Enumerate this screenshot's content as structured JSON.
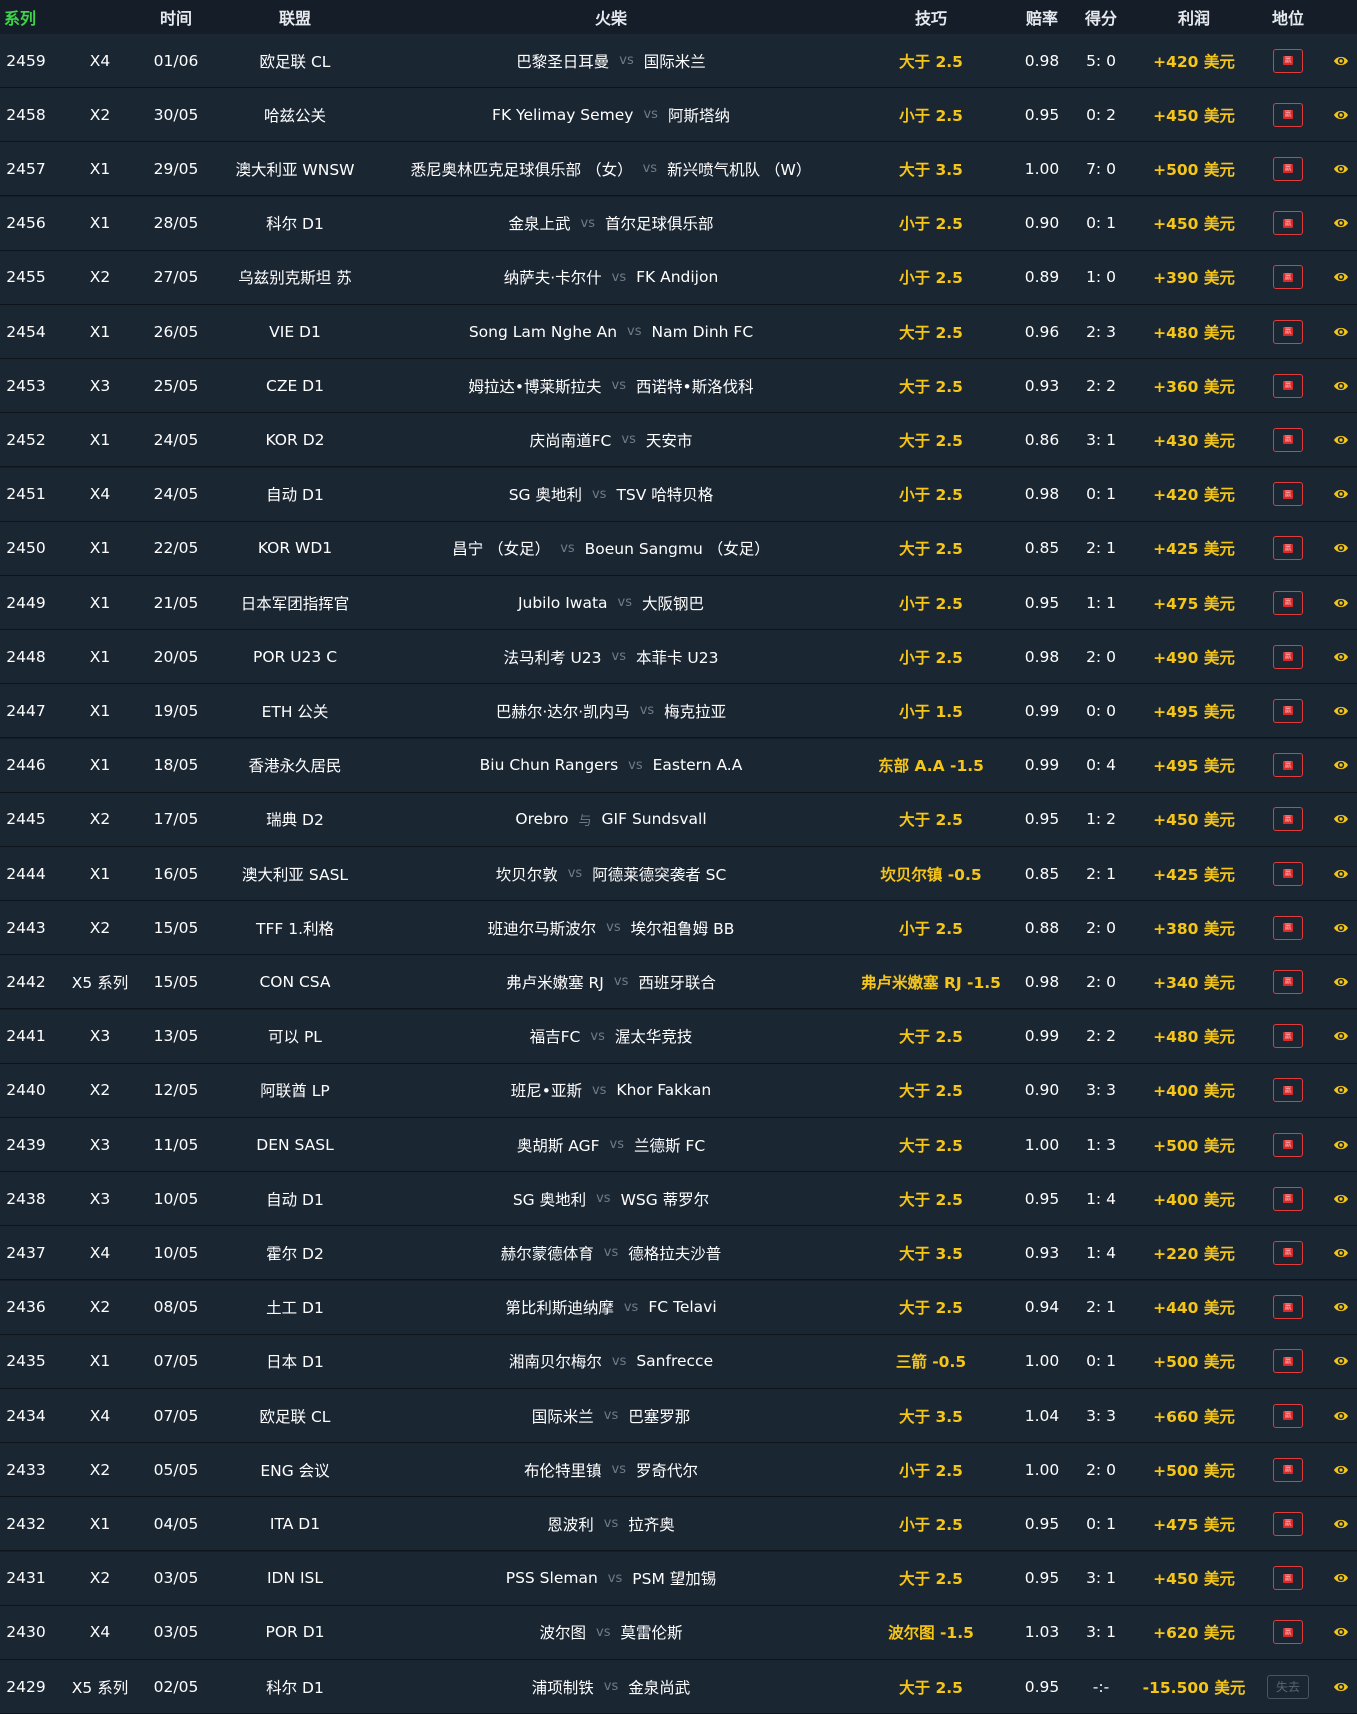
{
  "columns": [
    "系列",
    "",
    "时间",
    "联盟",
    "火柴",
    "技巧",
    "赔率",
    "得分",
    "利润",
    "地位"
  ],
  "accent_colors": {
    "header_id": "#3fd44a",
    "tip": "#f5c518",
    "win_badge": "#d82a2a",
    "background": "#141d28",
    "row": "#1b2633"
  },
  "rows": [
    {
      "id": "2459",
      "series": "X4",
      "date": "01/06",
      "league": "欧足联 CL",
      "home": "巴黎圣日耳曼",
      "sep": "vs",
      "away": "国际米兰",
      "tip": "大于 2.5",
      "odds": "0.98",
      "score": "5: 0",
      "profit": "+420 美元",
      "status": "赢"
    },
    {
      "id": "2458",
      "series": "X2",
      "date": "30/05",
      "league": "哈兹公关",
      "home": "FK Yelimay Semey",
      "sep": "vs",
      "away": "阿斯塔纳",
      "tip": "小于 2.5",
      "odds": "0.95",
      "score": "0: 2",
      "profit": "+450 美元",
      "status": "赢"
    },
    {
      "id": "2457",
      "series": "X1",
      "date": "29/05",
      "league": "澳大利亚 WNSW",
      "home": "悉尼奥林匹克足球俱乐部 （女）",
      "sep": "vs",
      "away": "新兴喷气机队 （W）",
      "tip": "大于 3.5",
      "odds": "1.00",
      "score": "7: 0",
      "profit": "+500 美元",
      "status": "赢"
    },
    {
      "id": "2456",
      "series": "X1",
      "date": "28/05",
      "league": "科尔 D1",
      "home": "金泉上武",
      "sep": "vs",
      "away": "首尔足球俱乐部",
      "tip": "小于 2.5",
      "odds": "0.90",
      "score": "0: 1",
      "profit": "+450 美元",
      "status": "赢"
    },
    {
      "id": "2455",
      "series": "X2",
      "date": "27/05",
      "league": "乌兹别克斯坦 苏",
      "home": "纳萨夫·卡尔什",
      "sep": "vs",
      "away": "FK Andijon",
      "tip": "小于 2.5",
      "odds": "0.89",
      "score": "1: 0",
      "profit": "+390 美元",
      "status": "赢"
    },
    {
      "id": "2454",
      "series": "X1",
      "date": "26/05",
      "league": "VIE D1",
      "home": "Song Lam Nghe An",
      "sep": "vs",
      "away": "Nam Dinh FC",
      "tip": "大于 2.5",
      "odds": "0.96",
      "score": "2: 3",
      "profit": "+480 美元",
      "status": "赢"
    },
    {
      "id": "2453",
      "series": "X3",
      "date": "25/05",
      "league": "CZE D1",
      "home": "姆拉达•博莱斯拉夫",
      "sep": "vs",
      "away": "西诺特•斯洛伐科",
      "tip": "大于 2.5",
      "odds": "0.93",
      "score": "2: 2",
      "profit": "+360 美元",
      "status": "赢"
    },
    {
      "id": "2452",
      "series": "X1",
      "date": "24/05",
      "league": "KOR D2",
      "home": "庆尚南道FC",
      "sep": "vs",
      "away": "天安市",
      "tip": "大于 2.5",
      "odds": "0.86",
      "score": "3: 1",
      "profit": "+430 美元",
      "status": "赢"
    },
    {
      "id": "2451",
      "series": "X4",
      "date": "24/05",
      "league": "自动 D1",
      "home": "SG 奥地利",
      "sep": "vs",
      "away": "TSV 哈特贝格",
      "tip": "小于 2.5",
      "odds": "0.98",
      "score": "0: 1",
      "profit": "+420 美元",
      "status": "赢"
    },
    {
      "id": "2450",
      "series": "X1",
      "date": "22/05",
      "league": "KOR WD1",
      "home": "昌宁 （女足）",
      "sep": "vs",
      "away": "Boeun Sangmu （女足）",
      "tip": "大于 2.5",
      "odds": "0.85",
      "score": "2: 1",
      "profit": "+425 美元",
      "status": "赢"
    },
    {
      "id": "2449",
      "series": "X1",
      "date": "21/05",
      "league": "日本军团指挥官",
      "home": "Jubilo Iwata",
      "sep": "vs",
      "away": "大阪钢巴",
      "tip": "小于 2.5",
      "odds": "0.95",
      "score": "1: 1",
      "profit": "+475 美元",
      "status": "赢"
    },
    {
      "id": "2448",
      "series": "X1",
      "date": "20/05",
      "league": "POR U23 C",
      "home": "法马利考 U23",
      "sep": "vs",
      "away": "本菲卡 U23",
      "tip": "小于 2.5",
      "odds": "0.98",
      "score": "2: 0",
      "profit": "+490 美元",
      "status": "赢"
    },
    {
      "id": "2447",
      "series": "X1",
      "date": "19/05",
      "league": "ETH 公关",
      "home": "巴赫尔·达尔·凯内马",
      "sep": "vs",
      "away": "梅克拉亚",
      "tip": "小于 1.5",
      "odds": "0.99",
      "score": "0: 0",
      "profit": "+495 美元",
      "status": "赢"
    },
    {
      "id": "2446",
      "series": "X1",
      "date": "18/05",
      "league": "香港永久居民",
      "home": "Biu Chun Rangers",
      "sep": "vs",
      "away": "Eastern A.A",
      "tip": "东部 A.A -1.5",
      "odds": "0.99",
      "score": "0: 4",
      "profit": "+495 美元",
      "status": "赢"
    },
    {
      "id": "2445",
      "series": "X2",
      "date": "17/05",
      "league": "瑞典 D2",
      "home": "Orebro",
      "sep": "与",
      "away": "GIF Sundsvall",
      "tip": "大于 2.5",
      "odds": "0.95",
      "score": "1: 2",
      "profit": "+450 美元",
      "status": "赢"
    },
    {
      "id": "2444",
      "series": "X1",
      "date": "16/05",
      "league": "澳大利亚 SASL",
      "home": "坎贝尔敦",
      "sep": "vs",
      "away": "阿德莱德突袭者 SC",
      "tip": "坎贝尔镇 -0.5",
      "odds": "0.85",
      "score": "2: 1",
      "profit": "+425 美元",
      "status": "赢"
    },
    {
      "id": "2443",
      "series": "X2",
      "date": "15/05",
      "league": "TFF 1.利格",
      "home": "班迪尔马斯波尔",
      "sep": "vs",
      "away": "埃尔祖鲁姆 BB",
      "tip": "小于 2.5",
      "odds": "0.88",
      "score": "2: 0",
      "profit": "+380 美元",
      "status": "赢"
    },
    {
      "id": "2442",
      "series": "X5 系列",
      "date": "15/05",
      "league": "CON CSA",
      "home": "弗卢米嫩塞 RJ",
      "sep": "vs",
      "away": "西班牙联合",
      "tip": "弗卢米嫩塞 RJ -1.5",
      "odds": "0.98",
      "score": "2: 0",
      "profit": "+340 美元",
      "status": "赢"
    },
    {
      "id": "2441",
      "series": "X3",
      "date": "13/05",
      "league": "可以 PL",
      "home": "福吉FC",
      "sep": "vs",
      "away": "渥太华竞技",
      "tip": "大于 2.5",
      "odds": "0.99",
      "score": "2: 2",
      "profit": "+480 美元",
      "status": "赢"
    },
    {
      "id": "2440",
      "series": "X2",
      "date": "12/05",
      "league": "阿联酋 LP",
      "home": "班尼•亚斯",
      "sep": "vs",
      "away": "Khor Fakkan",
      "tip": "大于 2.5",
      "odds": "0.90",
      "score": "3: 3",
      "profit": "+400 美元",
      "status": "赢"
    },
    {
      "id": "2439",
      "series": "X3",
      "date": "11/05",
      "league": "DEN SASL",
      "home": "奥胡斯 AGF",
      "sep": "vs",
      "away": "兰德斯 FC",
      "tip": "大于 2.5",
      "odds": "1.00",
      "score": "1: 3",
      "profit": "+500 美元",
      "status": "赢"
    },
    {
      "id": "2438",
      "series": "X3",
      "date": "10/05",
      "league": "自动 D1",
      "home": "SG 奥地利",
      "sep": "vs",
      "away": "WSG 蒂罗尔",
      "tip": "大于 2.5",
      "odds": "0.95",
      "score": "1: 4",
      "profit": "+400 美元",
      "status": "赢"
    },
    {
      "id": "2437",
      "series": "X4",
      "date": "10/05",
      "league": "霍尔 D2",
      "home": "赫尔蒙德体育",
      "sep": "vs",
      "away": "德格拉夫沙普",
      "tip": "大于 3.5",
      "odds": "0.93",
      "score": "1: 4",
      "profit": "+220 美元",
      "status": "赢"
    },
    {
      "id": "2436",
      "series": "X2",
      "date": "08/05",
      "league": "土工 D1",
      "home": "第比利斯迪纳摩",
      "sep": "vs",
      "away": "FC Telavi",
      "tip": "大于 2.5",
      "odds": "0.94",
      "score": "2: 1",
      "profit": "+440 美元",
      "status": "赢"
    },
    {
      "id": "2435",
      "series": "X1",
      "date": "07/05",
      "league": "日本 D1",
      "home": "湘南贝尔梅尔",
      "sep": "vs",
      "away": "Sanfrecce",
      "tip": "三箭 -0.5",
      "odds": "1.00",
      "score": "0: 1",
      "profit": "+500 美元",
      "status": "赢"
    },
    {
      "id": "2434",
      "series": "X4",
      "date": "07/05",
      "league": "欧足联 CL",
      "home": "国际米兰",
      "sep": "vs",
      "away": "巴塞罗那",
      "tip": "大于 3.5",
      "odds": "1.04",
      "score": "3: 3",
      "profit": "+660 美元",
      "status": "赢"
    },
    {
      "id": "2433",
      "series": "X2",
      "date": "05/05",
      "league": "ENG 会议",
      "home": "布伦特里镇",
      "sep": "vs",
      "away": "罗奇代尔",
      "tip": "小于 2.5",
      "odds": "1.00",
      "score": "2: 0",
      "profit": "+500 美元",
      "status": "赢"
    },
    {
      "id": "2432",
      "series": "X1",
      "date": "04/05",
      "league": "ITA D1",
      "home": "恩波利",
      "sep": "vs",
      "away": "拉齐奥",
      "tip": "小于 2.5",
      "odds": "0.95",
      "score": "0: 1",
      "profit": "+475 美元",
      "status": "赢"
    },
    {
      "id": "2431",
      "series": "X2",
      "date": "03/05",
      "league": "IDN ISL",
      "home": "PSS Sleman",
      "sep": "vs",
      "away": "PSM 望加锡",
      "tip": "大于 2.5",
      "odds": "0.95",
      "score": "3: 1",
      "profit": "+450 美元",
      "status": "赢"
    },
    {
      "id": "2430",
      "series": "X4",
      "date": "03/05",
      "league": "POR D1",
      "home": "波尔图",
      "sep": "vs",
      "away": "莫雷伦斯",
      "tip": "波尔图 -1.5",
      "odds": "1.03",
      "score": "3: 1",
      "profit": "+620 美元",
      "status": "赢"
    },
    {
      "id": "2429",
      "series": "X5 系列",
      "date": "02/05",
      "league": "科尔 D1",
      "home": "浦项制铁",
      "sep": "vs",
      "away": "金泉尚武",
      "tip": "大于 2.5",
      "odds": "0.95",
      "score": "-:-",
      "profit": "-15.500 美元",
      "status": "失去"
    }
  ]
}
